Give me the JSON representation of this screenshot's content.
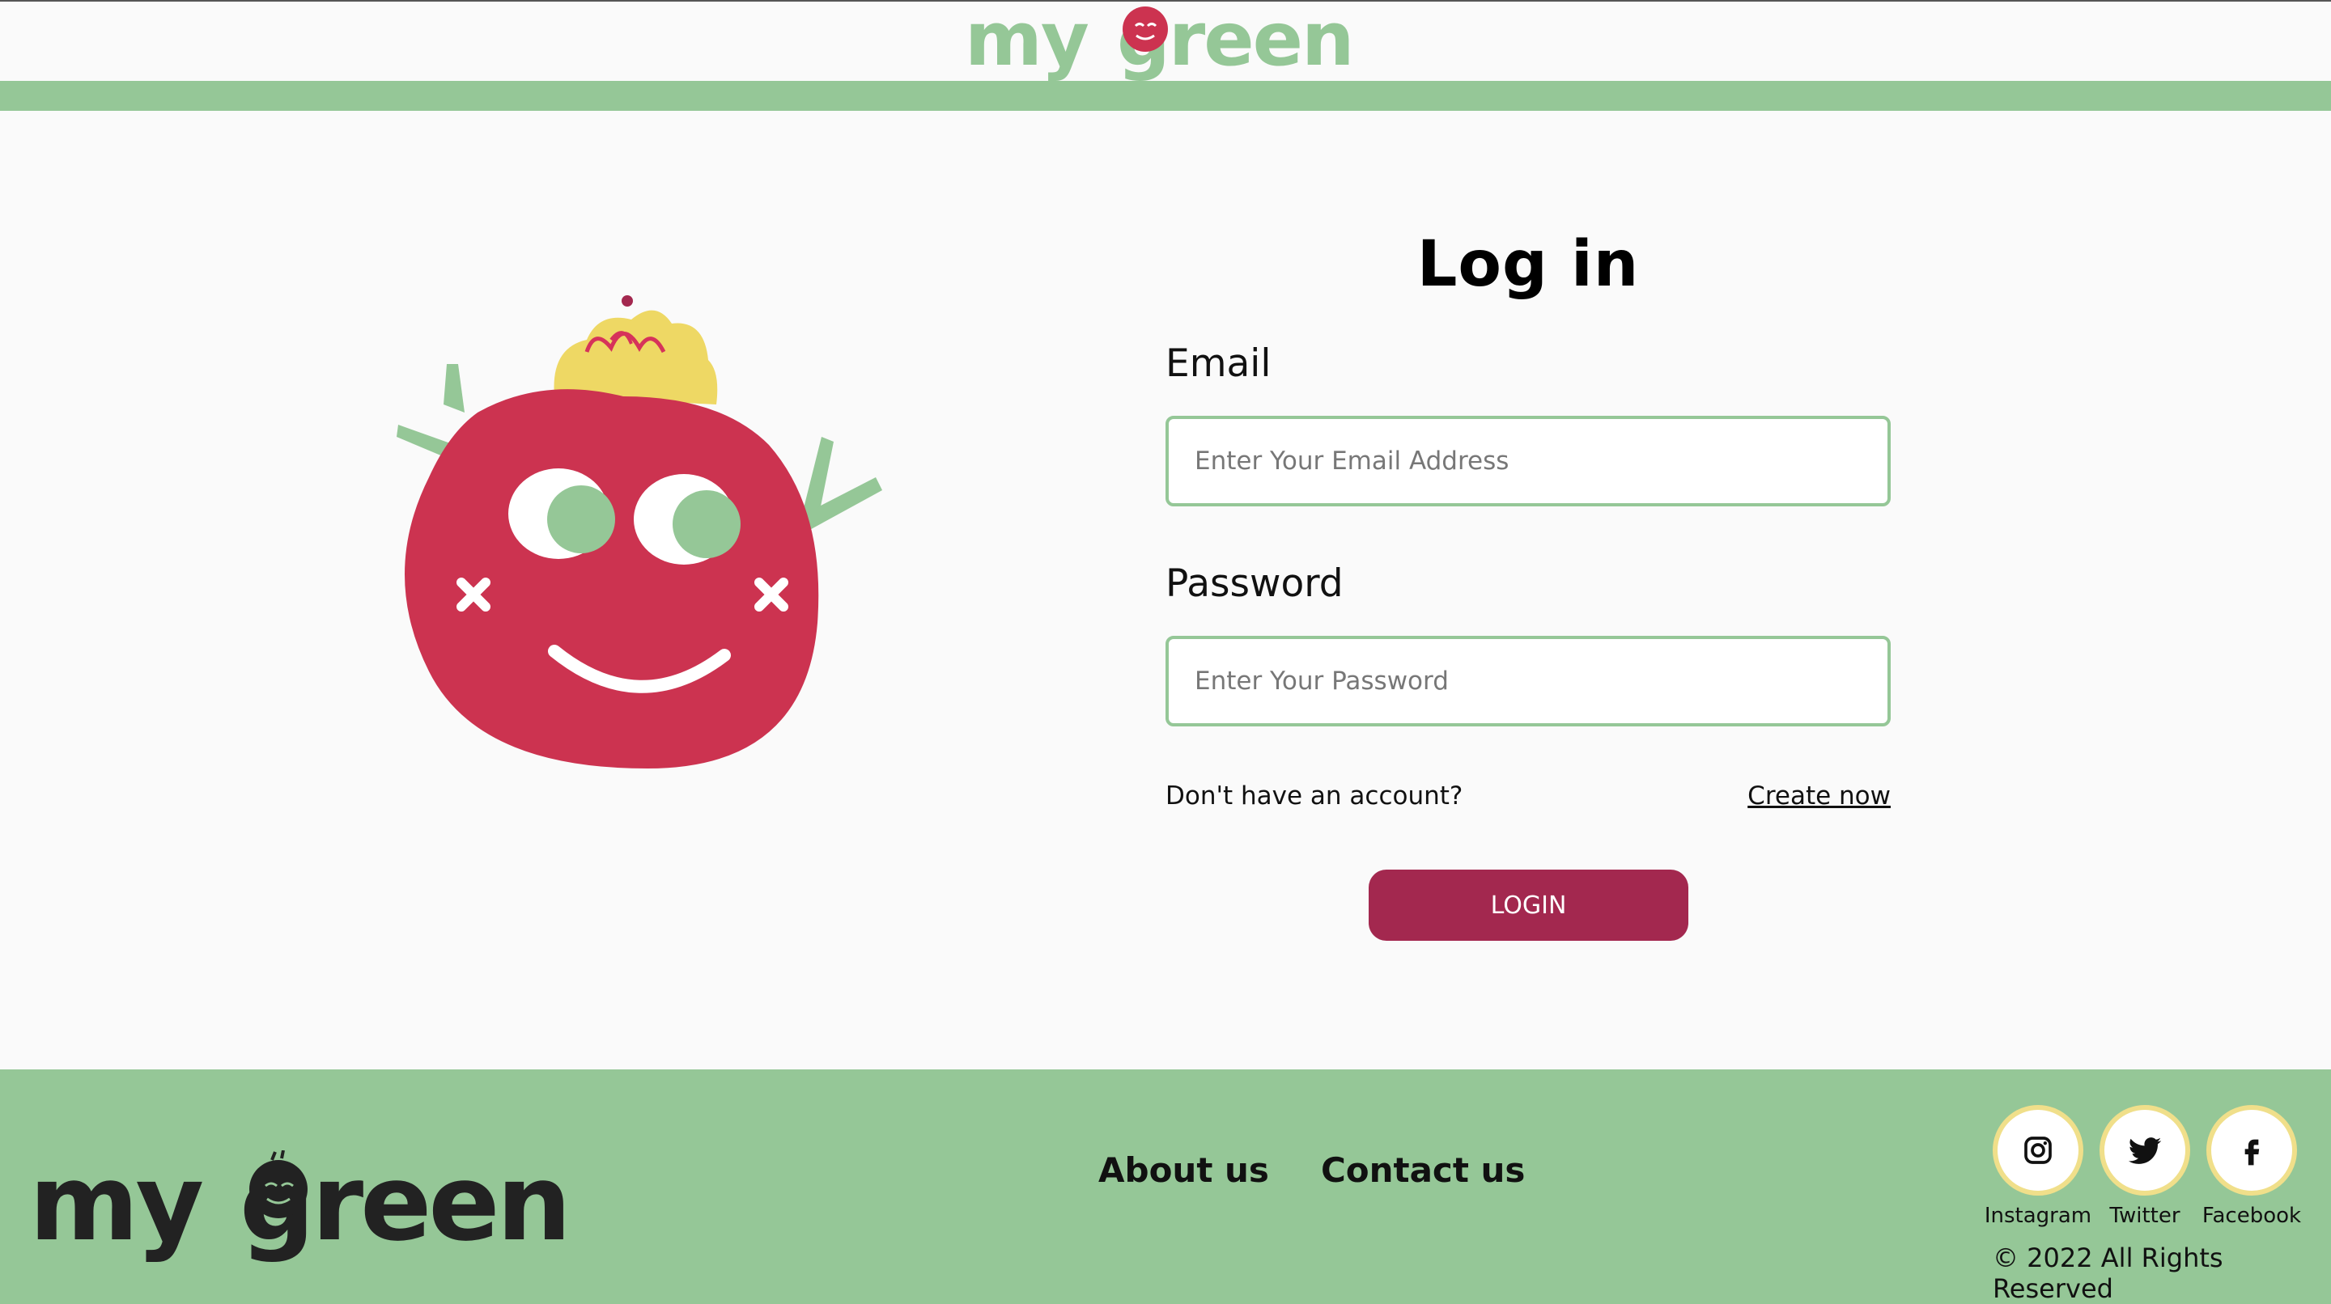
{
  "header": {
    "logo_text": "my green"
  },
  "colors": {
    "brand_green": "#95c797",
    "accent_red": "#a3284f",
    "mascot_red": "#cc3350",
    "crown_yellow": "#eed864"
  },
  "login": {
    "title": "Log in",
    "email_label": "Email",
    "email_placeholder": "Enter Your Email Address",
    "password_label": "Password",
    "password_placeholder": "Enter Your Password",
    "no_account_text": "Don't have an account?",
    "create_link": "Create now",
    "login_button": "LOGIN"
  },
  "footer": {
    "logo_text": "my green",
    "links": [
      "About us",
      "Contact us"
    ],
    "social": [
      {
        "name": "Instagram",
        "icon": "instagram-icon"
      },
      {
        "name": "Twitter",
        "icon": "twitter-icon"
      },
      {
        "name": "Facebook",
        "icon": "facebook-icon"
      }
    ],
    "copyright": "© 2022 All Rights Reserved"
  }
}
